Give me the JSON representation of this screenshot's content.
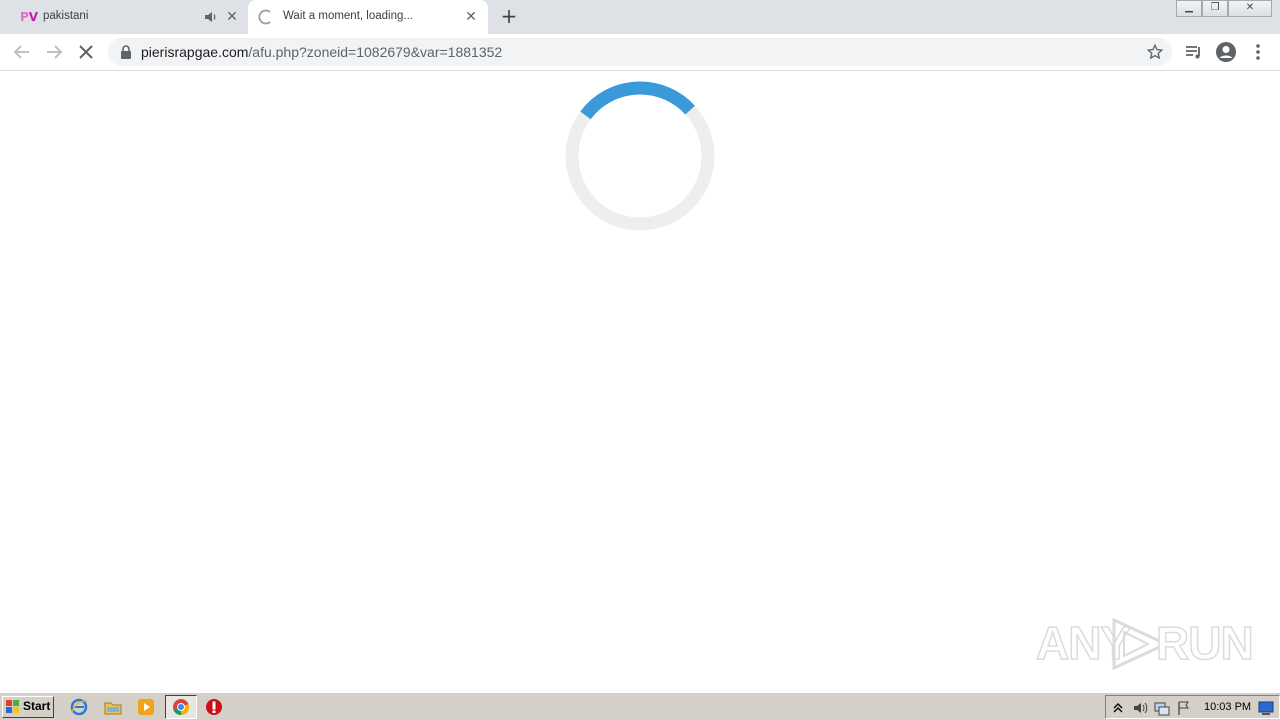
{
  "browser": {
    "tabs": [
      {
        "favicon_text_1": "P",
        "favicon_text_2": "V",
        "title": "pakistani",
        "active": false
      },
      {
        "title": "Wait a moment, loading...",
        "active": true
      }
    ],
    "new_tab_symbol": "+",
    "address": {
      "domain": "pierisrapgae.com",
      "path": "/afu.php?zoneid=1082679&var=1881352"
    },
    "icons": [
      "back-icon",
      "forward-icon",
      "stop-icon",
      "lock-icon",
      "star-icon",
      "media-icon",
      "profile-icon",
      "menu-icon"
    ]
  },
  "page": {
    "spinner_progress": 0.28,
    "spinner_color": "#3a9ad9",
    "spinner_track_color": "#eeeeee"
  },
  "watermark": {
    "text_left": "ANY",
    "text_right": "RUN"
  },
  "taskbar": {
    "start_label": "Start",
    "clock": "10:03 PM",
    "quick_launch": [
      "ie-icon",
      "folder-icon",
      "media-player-icon",
      "chrome-icon",
      "opera-icon"
    ]
  },
  "colors": {
    "tabstrip": "#dee1e6",
    "omnibox": "#f1f3f4",
    "taskbar": "#d4d0c8"
  }
}
